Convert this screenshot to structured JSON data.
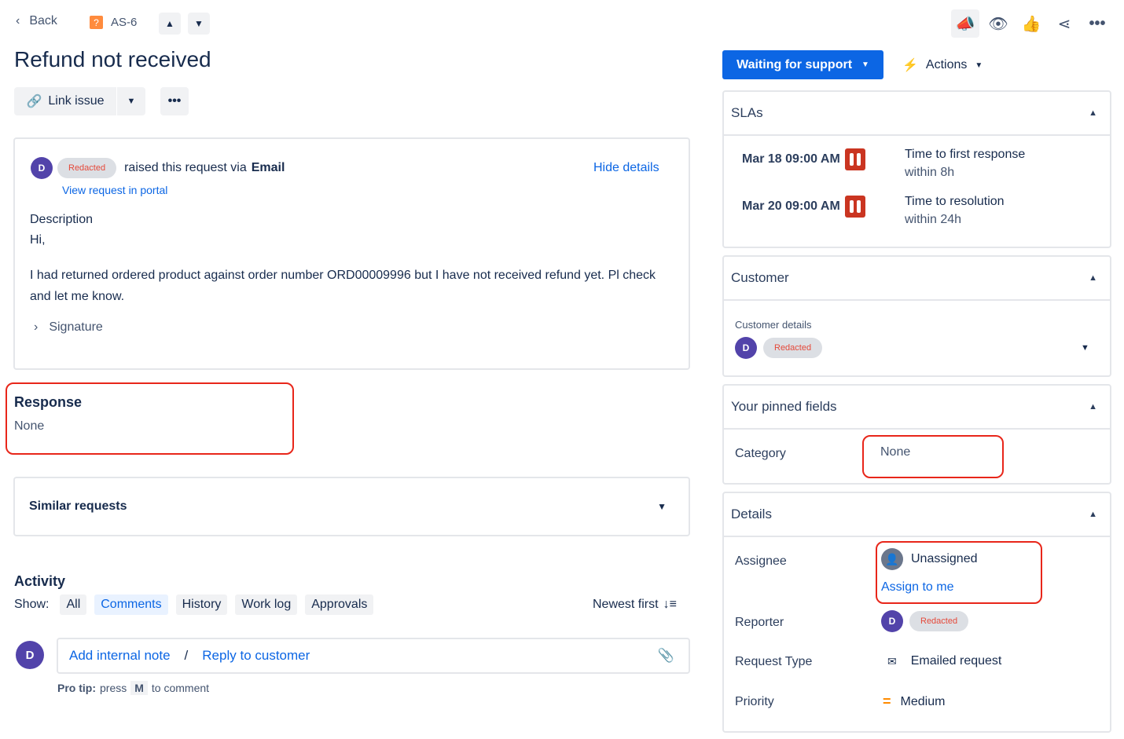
{
  "nav": {
    "back": "Back",
    "issue_key": "AS-6"
  },
  "title": "Refund not received",
  "toolbar": {
    "link_issue": "Link issue"
  },
  "request": {
    "reporter": "Redacted",
    "raised_text": "raised this request via",
    "channel": "Email",
    "hide_details": "Hide details",
    "view_portal": "View request in portal",
    "description_label": "Description",
    "greeting": "Hi,",
    "body": "I had returned ordered product against order number ORD00009996 but I have not received refund yet. Pl check and let me know.",
    "signature": "Signature"
  },
  "response": {
    "label": "Response",
    "value": "None"
  },
  "similar": {
    "label": "Similar requests"
  },
  "activity": {
    "label": "Activity",
    "show": "Show:",
    "filters": [
      "All",
      "Comments",
      "History",
      "Work log",
      "Approvals"
    ],
    "sort": "Newest first",
    "add_note": "Add internal note",
    "slash": "/",
    "reply": "Reply to customer",
    "protip_b": "Pro tip:",
    "protip_1": "press",
    "protip_key": "M",
    "protip_2": "to comment",
    "avatar": "D"
  },
  "status": {
    "label": "Waiting for support",
    "actions": "Actions"
  },
  "slas": {
    "label": "SLAs",
    "items": [
      {
        "time": "Mar 18 09:00 AM",
        "name": "Time to first response",
        "goal": "within 8h"
      },
      {
        "time": "Mar 20 09:00 AM",
        "name": "Time to resolution",
        "goal": "within 24h"
      }
    ]
  },
  "customer": {
    "label": "Customer",
    "details_label": "Customer details",
    "avatar": "D",
    "name": "Redacted"
  },
  "pinned": {
    "label": "Your pinned fields",
    "category_label": "Category",
    "category_value": "None"
  },
  "details": {
    "label": "Details",
    "assignee_label": "Assignee",
    "assignee": "Unassigned",
    "assign_me": "Assign to me",
    "reporter_label": "Reporter",
    "reporter_avatar": "D",
    "reporter": "Redacted",
    "type_label": "Request Type",
    "type": "Emailed request",
    "priority_label": "Priority",
    "priority": "Medium"
  }
}
